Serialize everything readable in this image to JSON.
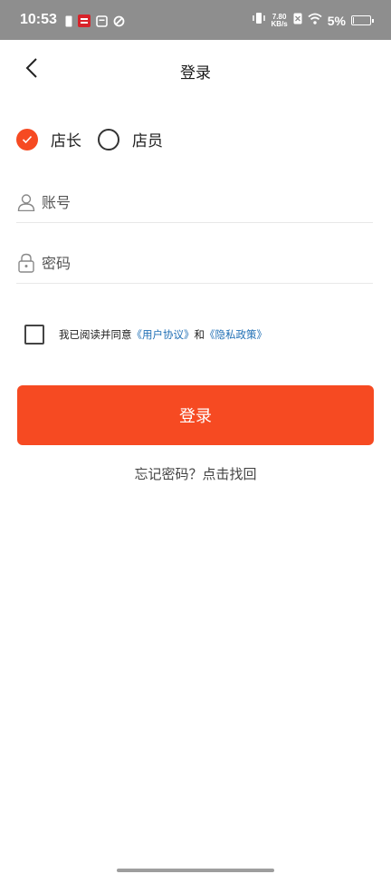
{
  "status_bar": {
    "time": "10:53",
    "net_speed_value": "7.80",
    "net_speed_unit": "KB/s",
    "battery_text": "5%",
    "battery_level": 0.05,
    "icons": [
      "sim-icon",
      "app-badge-icon",
      "shop-icon",
      "sync-icon",
      "vibrate-icon",
      "no-sim-icon",
      "wifi-icon",
      "battery-icon"
    ]
  },
  "header": {
    "title": "登录",
    "back_icon": "chevron-left-icon"
  },
  "roles": {
    "options": [
      {
        "label": "店长",
        "checked": true
      },
      {
        "label": "店员",
        "checked": false
      }
    ]
  },
  "form": {
    "account_placeholder": "账号",
    "account_value": "",
    "password_placeholder": "密码",
    "password_value": ""
  },
  "agreement": {
    "checked": false,
    "prefix": "我已阅读并同意",
    "user_agreement": "《用户协议》",
    "conjunction": "和",
    "privacy_policy": "《隐私政策》"
  },
  "actions": {
    "login_label": "登录",
    "forgot_label": "忘记密码？点击找回"
  },
  "colors": {
    "accent": "#f64a22",
    "link": "#1f6fb5",
    "status_bar_bg": "#8e8e8e"
  }
}
